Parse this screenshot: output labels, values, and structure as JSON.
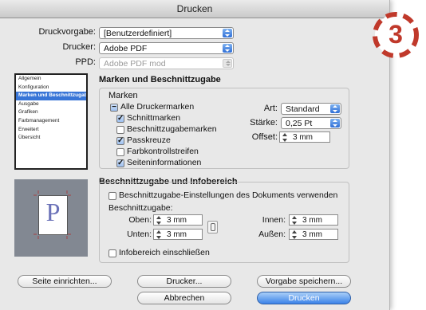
{
  "window": {
    "title": "Drucken"
  },
  "top": {
    "druckvorgabe_label": "Druckvorgabe:",
    "druckvorgabe_value": "[Benutzerdefiniert]",
    "drucker_label": "Drucker:",
    "drucker_value": "Adobe PDF",
    "ppd_label": "PPD:",
    "ppd_value": "Adobe PDF mod"
  },
  "sidebar": {
    "items": [
      {
        "label": "Allgemein"
      },
      {
        "label": "Konfiguration"
      },
      {
        "label": "Marken und Beschnittzugabe",
        "selected": true
      },
      {
        "label": "Ausgabe"
      },
      {
        "label": "Grafiken"
      },
      {
        "label": "Farbmanagement"
      },
      {
        "label": "Erweitert"
      },
      {
        "label": "Übersicht"
      }
    ]
  },
  "preview": {
    "letter": "P"
  },
  "section": {
    "title": "Marken und Beschnittzugabe"
  },
  "marken": {
    "title": "Marken",
    "all_label": "Alle Druckermarken",
    "all_state": "−",
    "items": [
      {
        "label": "Schnittmarken",
        "checked": true
      },
      {
        "label": "Beschnittzugabemarken",
        "checked": false
      },
      {
        "label": "Passkreuze",
        "checked": true
      },
      {
        "label": "Farbkontrollstreifen",
        "checked": false
      },
      {
        "label": "Seiteninformationen",
        "checked": true
      }
    ],
    "art_label": "Art:",
    "art_value": "Standard",
    "staerke_label": "Stärke:",
    "staerke_value": "0,25 Pt",
    "offset_label": "Offset:",
    "offset_value": "3 mm"
  },
  "bleed": {
    "title": "Beschnittzugabe und Infobereich",
    "use_doc_label": "Beschnittzugabe-Einstellungen des Dokuments verwenden",
    "sub_label": "Beschnittzugabe:",
    "oben_label": "Oben:",
    "oben_value": "3 mm",
    "unten_label": "Unten:",
    "unten_value": "3 mm",
    "innen_label": "Innen:",
    "innen_value": "3 mm",
    "aussen_label": "Außen:",
    "aussen_value": "3 mm",
    "info_label": "Infobereich einschließen"
  },
  "buttons": {
    "setup": "Seite einrichten...",
    "printer": "Drucker...",
    "save_preset": "Vorgabe speichern...",
    "cancel": "Abbrechen",
    "print": "Drucken"
  },
  "badge": {
    "number": "3",
    "color": "#c0392b"
  },
  "colors": {
    "selection": "#3875d7",
    "default_button": "#3b82e8"
  }
}
